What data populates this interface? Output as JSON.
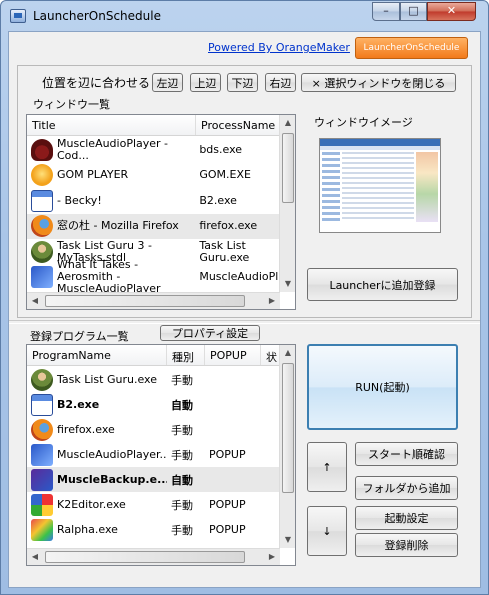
{
  "window": {
    "title": "LauncherOnSchedule",
    "min_label": "–",
    "max_label": "□",
    "close_label": "✕"
  },
  "header": {
    "powered_link": "Powered By OrangeMaker",
    "brand_button": "LauncherOnSchedule"
  },
  "align": {
    "label": "位置を辺に合わせる",
    "left": "左辺",
    "top": "上辺",
    "bottom": "下辺",
    "right": "右辺",
    "close_selected": "× 選択ウィンドウを閉じる"
  },
  "window_list": {
    "label": "ウィンドウ一覧",
    "columns": [
      "Title",
      "ProcessName"
    ],
    "rows": [
      {
        "icon": "helmet-icon",
        "title": "MuscleAudioPlayer - Cod...",
        "process": "bds.exe"
      },
      {
        "icon": "gom-icon",
        "title": "GOM PLAYER",
        "process": "GOM.EXE"
      },
      {
        "icon": "becky-icon",
        "title": "- Becky!",
        "process": "B2.exe"
      },
      {
        "icon": "firefox-icon",
        "title": "窓の杜 - Mozilla Firefox",
        "process": "firefox.exe"
      },
      {
        "icon": "guru-icon",
        "title": "Task List Guru 3 - MyTasks.stdl",
        "process": "Task List Guru.exe"
      },
      {
        "icon": "music-icon",
        "title": "What It Takes - Aerosmith - MuscleAudioPlayer",
        "process": "MuscleAudioPla..."
      }
    ]
  },
  "preview": {
    "label": "ウィンドウイメージ"
  },
  "add_launcher": "Launcherに追加登録",
  "registered": {
    "label": "登録プログラム一覧",
    "properties_button": "プロパティ設定",
    "columns": [
      "ProgramName",
      "種別",
      "POPUP",
      "状"
    ],
    "rows": [
      {
        "icon": "guru-icon",
        "name": "Task List Guru.exe",
        "type": "手動",
        "popup": "",
        "bold": false
      },
      {
        "icon": "becky-icon",
        "name": "B2.exe",
        "type": "自動",
        "popup": "",
        "bold": true
      },
      {
        "icon": "firefox-icon",
        "name": "firefox.exe",
        "type": "手動",
        "popup": "",
        "bold": false
      },
      {
        "icon": "music-icon",
        "name": "MuscleAudioPlayer....",
        "type": "手動",
        "popup": "POPUP",
        "bold": false
      },
      {
        "icon": "cube-icon",
        "name": "MuscleBackup.e...",
        "type": "自動",
        "popup": "",
        "bold": true
      },
      {
        "icon": "k2-icon",
        "name": "K2Editor.exe",
        "type": "手動",
        "popup": "POPUP",
        "bold": false
      },
      {
        "icon": "ralpha-icon",
        "name": "Ralpha.exe",
        "type": "手動",
        "popup": "POPUP",
        "bold": false
      }
    ]
  },
  "actions": {
    "run": "RUN(起動)",
    "up": "↑",
    "down": "↓",
    "start_order": "スタート順確認",
    "add_from_folder": "フォルダから追加",
    "launch_settings": "起動設定",
    "delete_registration": "登録削除"
  },
  "colors": {
    "link": "#0033cc",
    "brand_button": "#f27a1a",
    "run_border": "#3c7fb1"
  }
}
